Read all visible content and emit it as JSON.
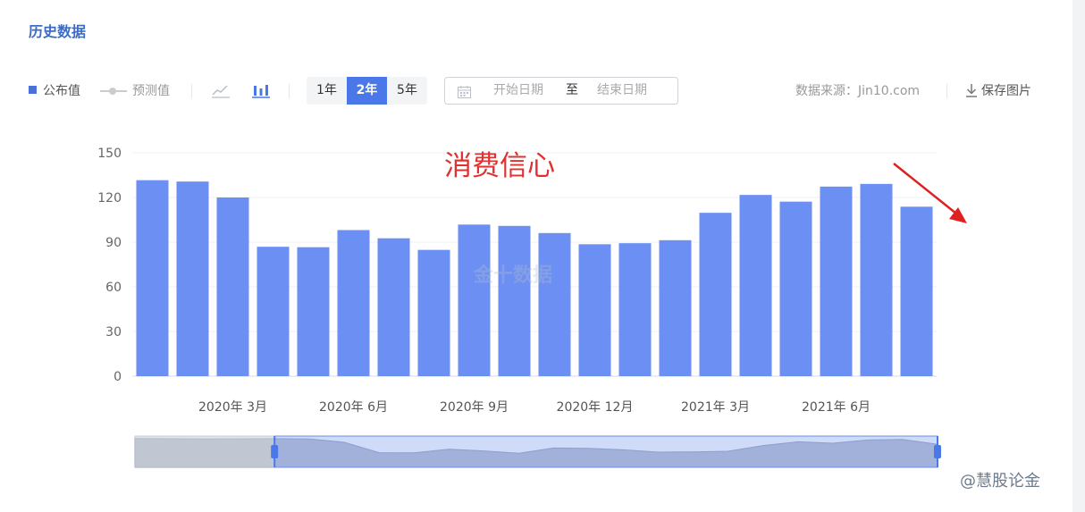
{
  "header": {
    "title": "历史数据"
  },
  "toolbar": {
    "legend_published": "公布值",
    "legend_predicted": "预测值",
    "ranges": [
      "1年",
      "2年",
      "5年"
    ],
    "active_range": "2年",
    "date_start_placeholder": "开始日期",
    "date_to": "至",
    "date_end_placeholder": "结束日期",
    "source": "数据来源：Jin10.com",
    "save_label": "保存图片"
  },
  "annotation": "消费信心",
  "watermark": "金十数据",
  "footer_logo": "@慧股论金",
  "colors": {
    "bar": "#6b8ff2",
    "accent": "#4a78e8",
    "annotation": "#e03131"
  },
  "chart_data": {
    "type": "bar",
    "categories": [
      "2020-01",
      "2020-02",
      "2020-03",
      "2020-04",
      "2020-05",
      "2020-06",
      "2020-07",
      "2020-08",
      "2020-09",
      "2020-10",
      "2020-11",
      "2020-12",
      "2021-01",
      "2021-02",
      "2021-03",
      "2021-04",
      "2021-05",
      "2021-06",
      "2021-07",
      "2021-08"
    ],
    "values": [
      131.6,
      130.7,
      120.0,
      86.9,
      86.6,
      98.1,
      92.6,
      84.8,
      101.8,
      100.9,
      96.1,
      88.6,
      89.3,
      91.3,
      109.7,
      121.7,
      117.2,
      127.3,
      129.1,
      113.8
    ],
    "xticks": [
      {
        "index": 2,
        "label": "2020年 3月"
      },
      {
        "index": 5,
        "label": "2020年 6月"
      },
      {
        "index": 8,
        "label": "2020年 9月"
      },
      {
        "index": 11,
        "label": "2020年 12月"
      },
      {
        "index": 14,
        "label": "2021年 3月"
      },
      {
        "index": 17,
        "label": "2021年 6月"
      }
    ],
    "yticks": [
      0,
      30,
      60,
      90,
      120,
      150
    ],
    "ylim": [
      0,
      150
    ],
    "grid": true,
    "legend": "top-left"
  },
  "navigator_data": {
    "values": [
      131.9,
      131.4,
      130.9,
      131.2,
      131.6,
      130.7,
      120.0,
      86.9,
      86.6,
      98.1,
      92.6,
      84.8,
      101.8,
      100.9,
      96.1,
      88.6,
      89.3,
      91.3,
      109.7,
      121.7,
      117.2,
      127.3,
      129.1,
      113.8
    ],
    "selected_from_index": 4,
    "selected_to_index": 23
  }
}
